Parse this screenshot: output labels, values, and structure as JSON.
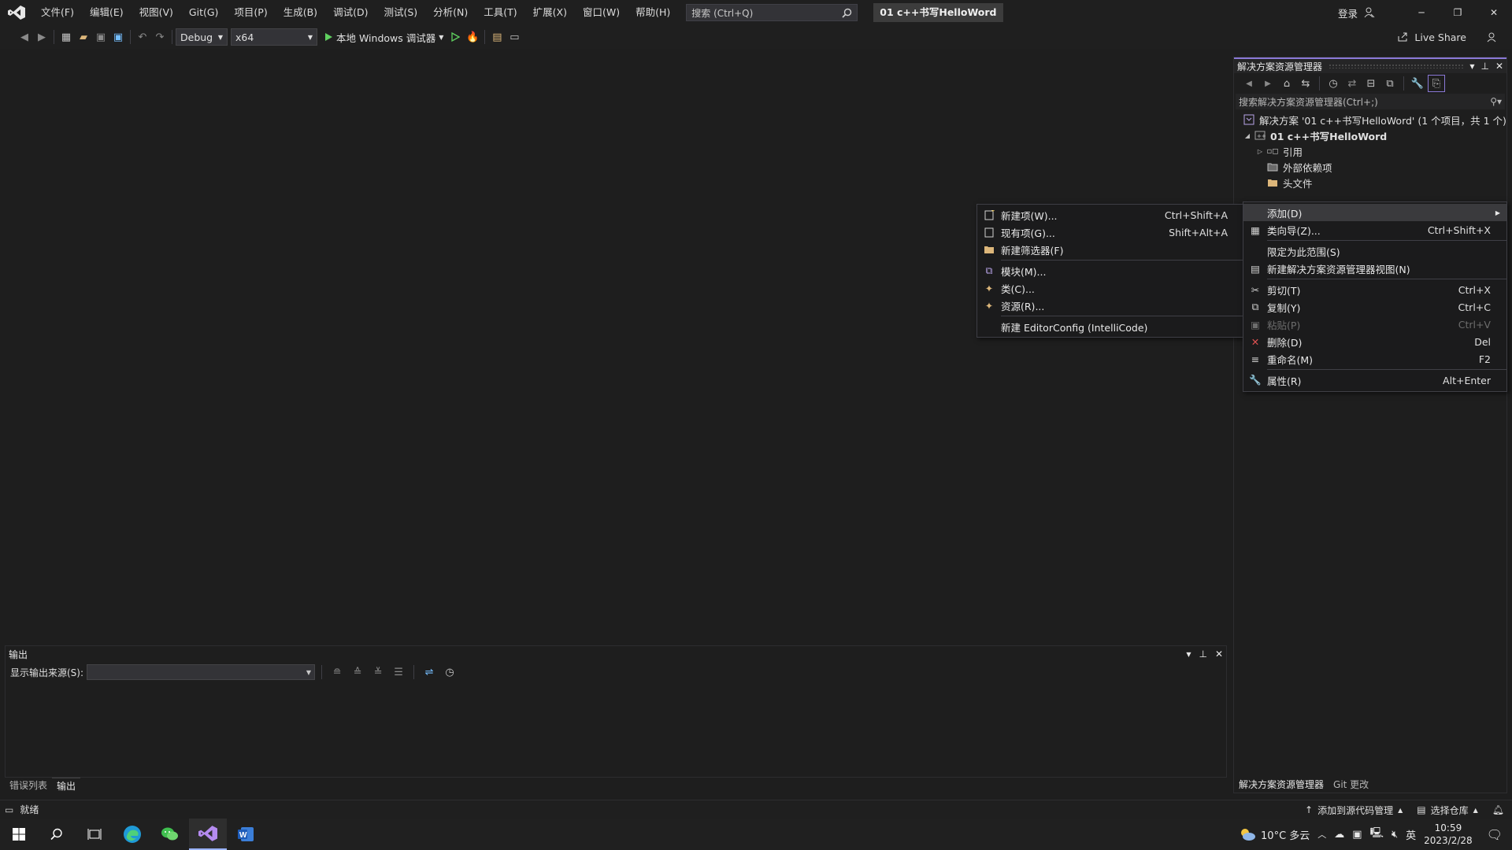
{
  "menubar": {
    "items": [
      "文件(F)",
      "编辑(E)",
      "视图(V)",
      "Git(G)",
      "项目(P)",
      "生成(B)",
      "调试(D)",
      "测试(S)",
      "分析(N)",
      "工具(T)",
      "扩展(X)",
      "窗口(W)",
      "帮助(H)"
    ]
  },
  "search": {
    "label": "搜索 (Ctrl+Q)"
  },
  "title_badge": "01 c++书写HelloWord",
  "account": {
    "signin": "登录"
  },
  "toolbar": {
    "config": "Debug",
    "platform": "x64",
    "run_label": "本地 Windows 调试器",
    "live_share": "Live Share"
  },
  "solution_explorer": {
    "title": "解决方案资源管理器",
    "search_placeholder": "搜索解决方案资源管理器(Ctrl+;)",
    "tree": {
      "solution": "解决方案 '01 c++书写HelloWord' (1 个项目，共 1 个)",
      "project": "01 c++书写HelloWord",
      "references": "引用",
      "external_deps": "外部依赖项",
      "header_files": "头文件"
    },
    "tabs": [
      "解决方案资源管理器",
      "Git 更改"
    ]
  },
  "context_menu": {
    "items": [
      {
        "label": "添加(D)",
        "shortcut": ""
      },
      {
        "label": "类向导(Z)...",
        "shortcut": "Ctrl+Shift+X"
      },
      {
        "label": "限定为此范围(S)",
        "shortcut": ""
      },
      {
        "label": "新建解决方案资源管理器视图(N)",
        "shortcut": ""
      },
      {
        "label": "剪切(T)",
        "shortcut": "Ctrl+X"
      },
      {
        "label": "复制(Y)",
        "shortcut": "Ctrl+C"
      },
      {
        "label": "粘贴(P)",
        "shortcut": "Ctrl+V"
      },
      {
        "label": "删除(D)",
        "shortcut": "Del"
      },
      {
        "label": "重命名(M)",
        "shortcut": "F2"
      },
      {
        "label": "属性(R)",
        "shortcut": "Alt+Enter"
      }
    ]
  },
  "add_submenu": {
    "items": [
      {
        "label": "新建项(W)...",
        "shortcut": "Ctrl+Shift+A"
      },
      {
        "label": "现有项(G)...",
        "shortcut": "Shift+Alt+A"
      },
      {
        "label": "新建筛选器(F)",
        "shortcut": ""
      },
      {
        "label": "模块(M)...",
        "shortcut": ""
      },
      {
        "label": "类(C)...",
        "shortcut": ""
      },
      {
        "label": "资源(R)...",
        "shortcut": ""
      },
      {
        "label": "新建 EditorConfig (IntelliCode)",
        "shortcut": ""
      }
    ]
  },
  "output": {
    "title": "输出",
    "source_label": "显示输出来源(S):",
    "source_value": ""
  },
  "bottom_tabs": [
    "错误列表",
    "输出"
  ],
  "status": {
    "ready": "就绪",
    "add_source_control": "添加到源代码管理",
    "select_repo": "选择仓库"
  },
  "taskbar": {
    "weather": "10°C 多云",
    "ime": "英",
    "time": "10:59",
    "date": "2023/2/28"
  },
  "colors": {
    "accent": "#8a78d6",
    "delete_red": "#e05252",
    "run_green": "#5fd05f"
  }
}
